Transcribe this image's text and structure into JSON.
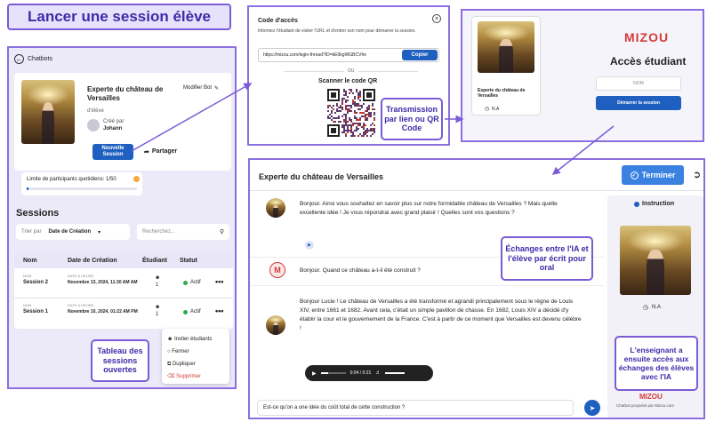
{
  "title": "Lancer une session élève",
  "left": {
    "back_label": "Chatbots",
    "bot_name": "Experte du château de Versailles",
    "bot_sub": "d'élève",
    "edit_label": "Modifier Bot",
    "created_by_label": "Créé par",
    "created_by_name": "Johann",
    "new_session_label": "Nouvelle Session",
    "share_label": "Partager",
    "limit_label": "Limite de participants quotidiens: 1/50",
    "sessions_heading": "Sessions",
    "sort_label": "Trier par",
    "sort_value": "Date de Création",
    "search_placeholder": "Recherchez...",
    "columns": [
      "Nom",
      "Date de Création",
      "Étudiant",
      "Statut"
    ],
    "rows": [
      {
        "name_top": "NOM",
        "name": "Session 2",
        "date_top": "DATE & HEURE",
        "date": "Novembre 13, 2024, 11:30 AM AM",
        "students": "1",
        "status": "Actif"
      },
      {
        "name_top": "NOM",
        "name": "Session 1",
        "date_top": "DATE & HEURE",
        "date": "Novembre 10, 2024, 01:22 AM PM",
        "students": "1",
        "status": "Actif"
      }
    ],
    "menu": [
      "Inviter étudiants",
      "Fermer",
      "Dupliquer",
      "Supprimer"
    ],
    "callout": "Tableau des sessions ouvertes"
  },
  "access": {
    "title": "Code d'accès",
    "description": "Informez l'étudiant de visiter l'URL et d'entrer son nom pour démarrer la session.",
    "url": "https://mizou.com/login-thread?ID=kE0kgWGBCVhe",
    "copy_label": "Copier",
    "or_label": "OU",
    "qr_label": "Scanner le code QR"
  },
  "transmission_callout": "Transmission par lien ou QR Code",
  "student": {
    "brand": "MIZOU",
    "heading": "Accès étudiant",
    "name_placeholder": "NOM",
    "start_label": "Démarrer la session",
    "bot_name": "Experte du château de Versailles",
    "lang": "N.A"
  },
  "chat": {
    "title": "Experte du château de Versailles",
    "finish_label": "Terminer",
    "msg1": "Bonjour. Ainsi vous souhaitez en savoir plus sur notre formidable château de Versailles ? Mais quelle excellente idée ! Je vous répondrai avec grand plaisir ! Quelles sont vos questions ?",
    "user_initial": "M",
    "msg2": "Bonjour. Quand ce château a-t-il été construit ?",
    "msg3": "Bonjour Lucie ! Le château de Versailles a été transformé et agrandi principalement sous le règne de Louis XIV, entre 1661 et 1682. Avant cela, c'était un simple pavillon de chasse. En 1682, Louis XIV a décidé d'y établir la cour et le gouvernement de la France. C'est à partir de ce moment que Versailles est devenu célèbre !",
    "audio_time": "0:04 / 0:21",
    "input_value": "Est-ce qu'on a une idée du coût total de cette construction ?",
    "instruction_label": "Instruction",
    "lang": "N.A",
    "brand": "MIZOU",
    "powered": "Chatbot propulsé par Mizou.com",
    "callout_exchange": "Échanges entre l'IA et l'élève par écrit pour oral",
    "callout_teacher": "L'enseignant a ensuite accès aux échanges des élèves avec l'IA"
  },
  "colors": {
    "accent": "#7b5cd6",
    "button": "#1f5fbf",
    "brand": "#d43a3a"
  }
}
